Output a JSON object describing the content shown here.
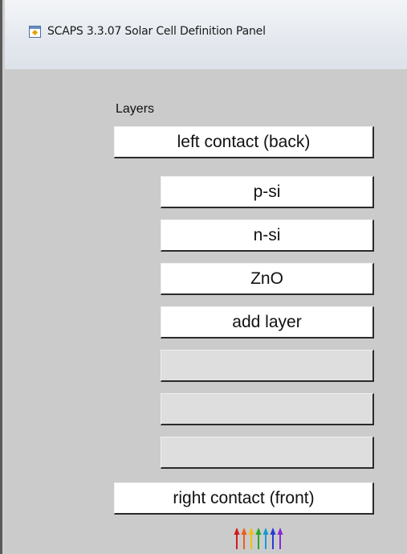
{
  "window": {
    "title": "SCAPS 3.3.07 Solar Cell Definition Panel",
    "icon": "scaps-app-icon"
  },
  "layers_panel": {
    "label": "Layers",
    "left_contact": "left contact (back)",
    "layers": [
      "p-si",
      "n-si",
      "ZnO",
      "add layer",
      "",
      "",
      ""
    ],
    "right_contact": "right contact (front)"
  },
  "illumination": {
    "icon": "illumination-arrows-icon",
    "colors": [
      "#d21a1a",
      "#e8601a",
      "#e8c21a",
      "#2aa52a",
      "#1a9ad2",
      "#2a3ad2",
      "#8a2ad2"
    ]
  }
}
